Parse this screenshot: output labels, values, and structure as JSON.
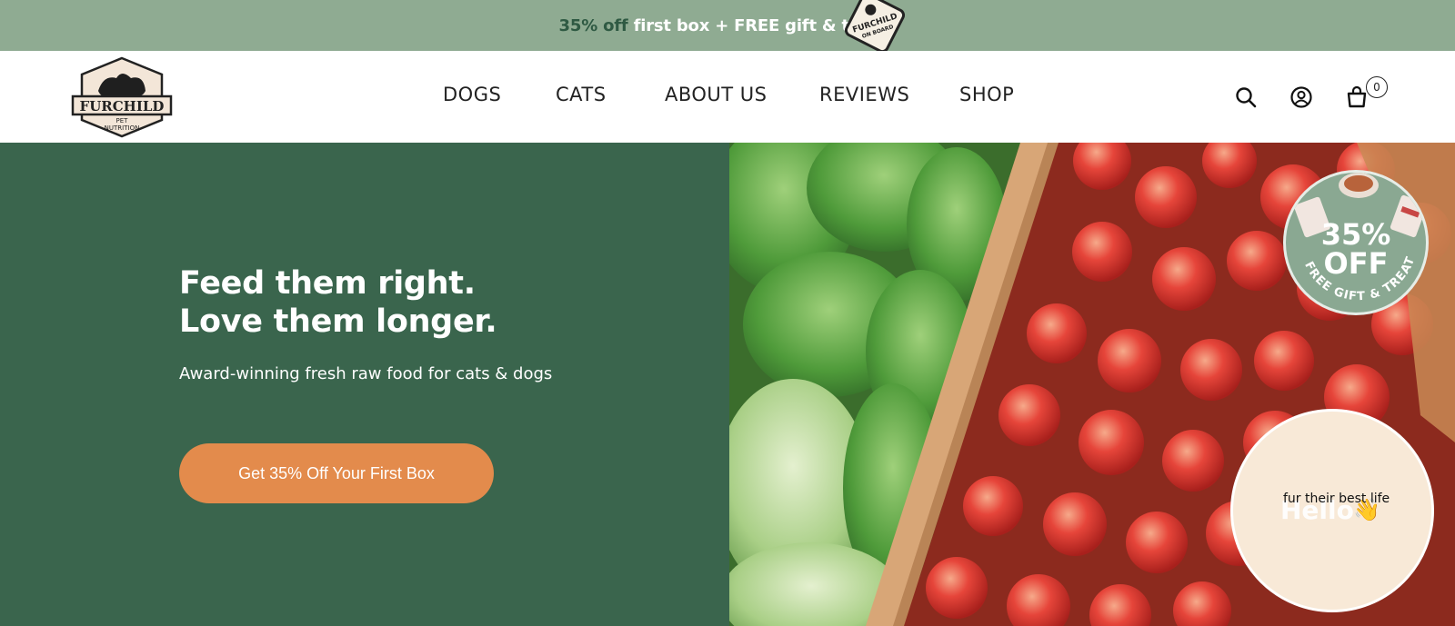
{
  "announcement": {
    "accent": "35% off",
    "rest": " first box + FREE gift & treats",
    "sticker_line1": "FURCHILD",
    "sticker_line2": "ON BOARD"
  },
  "header": {
    "logo_name": "FURCHILD",
    "logo_sub1": "PET",
    "logo_sub2": "NUTRITION",
    "nav": [
      {
        "label": "DOGS"
      },
      {
        "label": "CATS"
      },
      {
        "label": "ABOUT US"
      },
      {
        "label": "REVIEWS"
      },
      {
        "label": "SHOP"
      }
    ],
    "cart_count": "0",
    "icons": [
      "search-icon",
      "account-icon",
      "cart-icon"
    ]
  },
  "hero": {
    "title_line1": "Feed them right.",
    "title_line2": "Love them longer.",
    "subtitle": "Award-winning fresh raw food for cats & dogs",
    "cta_label": "Get 35% Off Your First Box",
    "image_subject": "lettuce-and-apples-box-photo"
  },
  "promo_badge": {
    "big_line1": "35%",
    "big_line2": "OFF",
    "arc_text": "+ FREE GIFT & TREATS"
  },
  "chat_widget": {
    "greeting": "Hello",
    "wave": "👋",
    "tagline": "fur their best life"
  },
  "colors": {
    "announcement_bg": "#8fab92",
    "accent_green": "#2f5a43",
    "hero_green": "#3a654d",
    "cta_orange": "#e38b4c",
    "chat_bg": "#f8e9d7"
  }
}
